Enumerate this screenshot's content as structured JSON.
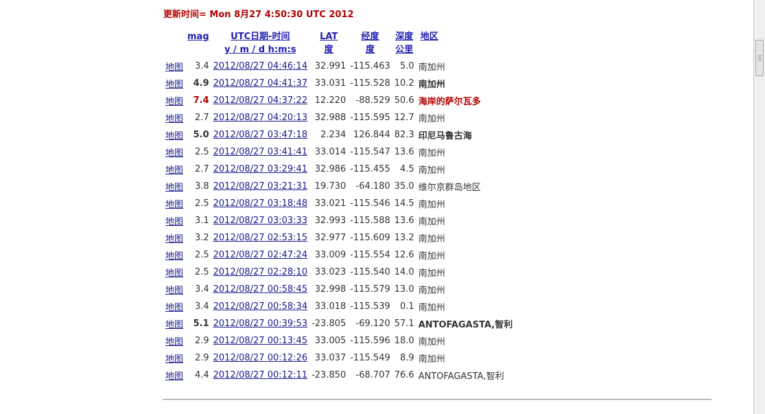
{
  "update": "更新时间= Mon 8月27 4:50:30 UTC 2012",
  "headers": {
    "mag": "mag",
    "date_line1": "UTC日期-时间",
    "date_line2": "y / m / d h:m:s",
    "lat_line1": "LAT",
    "lat_line2": "度",
    "lon_line1": "经度",
    "lon_line2": "度",
    "depth_line1": "深度",
    "depth_line2": "公里",
    "region": "地区"
  },
  "rows": [
    {
      "map": "地图",
      "mag": "3.4",
      "date": "2012/08/27 04:46:14",
      "lat": "32.991",
      "lon": "-115.463",
      "depth": "5.0",
      "region": "南加州",
      "style": "normal"
    },
    {
      "map": "地图",
      "mag": "4.9",
      "date": "2012/08/27 04:41:37",
      "lat": "33.031",
      "lon": "-115.528",
      "depth": "10.2",
      "region": "南加州",
      "style": "bold"
    },
    {
      "map": "地图",
      "mag": "7.4",
      "date": "2012/08/27 04:37:22",
      "lat": "12.220",
      "lon": "-88.529",
      "depth": "50.6",
      "region": "海岸的萨尔瓦多",
      "style": "red"
    },
    {
      "map": "地图",
      "mag": "2.7",
      "date": "2012/08/27 04:20:13",
      "lat": "32.988",
      "lon": "-115.595",
      "depth": "12.7",
      "region": "南加州",
      "style": "normal"
    },
    {
      "map": "地图",
      "mag": "5.0",
      "date": "2012/08/27 03:47:18",
      "lat": "2.234",
      "lon": "126.844",
      "depth": "82.3",
      "region": "印尼马鲁古海",
      "style": "bold"
    },
    {
      "map": "地图",
      "mag": "2.5",
      "date": "2012/08/27 03:41:41",
      "lat": "33.014",
      "lon": "-115.547",
      "depth": "13.6",
      "region": "南加州",
      "style": "normal"
    },
    {
      "map": "地图",
      "mag": "2.7",
      "date": "2012/08/27 03:29:41",
      "lat": "32.986",
      "lon": "-115.455",
      "depth": "4.5",
      "region": "南加州",
      "style": "normal"
    },
    {
      "map": "地图",
      "mag": "3.8",
      "date": "2012/08/27 03:21:31",
      "lat": "19.730",
      "lon": "-64.180",
      "depth": "35.0",
      "region": "维尔京群岛地区",
      "style": "normal"
    },
    {
      "map": "地图",
      "mag": "2.5",
      "date": "2012/08/27 03:18:48",
      "lat": "33.021",
      "lon": "-115.546",
      "depth": "14.5",
      "region": "南加州",
      "style": "normal"
    },
    {
      "map": "地图",
      "mag": "3.1",
      "date": "2012/08/27 03:03:33",
      "lat": "32.993",
      "lon": "-115.588",
      "depth": "13.6",
      "region": "南加州",
      "style": "normal"
    },
    {
      "map": "地图",
      "mag": "3.2",
      "date": "2012/08/27 02:53:15",
      "lat": "32.977",
      "lon": "-115.609",
      "depth": "13.2",
      "region": "南加州",
      "style": "normal"
    },
    {
      "map": "地图",
      "mag": "2.5",
      "date": "2012/08/27 02:47:24",
      "lat": "33.009",
      "lon": "-115.554",
      "depth": "12.6",
      "region": "南加州",
      "style": "normal"
    },
    {
      "map": "地图",
      "mag": "2.5",
      "date": "2012/08/27 02:28:10",
      "lat": "33.023",
      "lon": "-115.540",
      "depth": "14.0",
      "region": "南加州",
      "style": "normal"
    },
    {
      "map": "地图",
      "mag": "3.4",
      "date": "2012/08/27 00:58:45",
      "lat": "32.998",
      "lon": "-115.579",
      "depth": "13.0",
      "region": "南加州",
      "style": "normal"
    },
    {
      "map": "地图",
      "mag": "3.4",
      "date": "2012/08/27 00:58:34",
      "lat": "33.018",
      "lon": "-115.539",
      "depth": "0.1",
      "region": "南加州",
      "style": "normal"
    },
    {
      "map": "地图",
      "mag": "5.1",
      "date": "2012/08/27 00:39:53",
      "lat": "-23.805",
      "lon": "-69.120",
      "depth": "57.1",
      "region": "ANTOFAGASTA,智利",
      "style": "bold"
    },
    {
      "map": "地图",
      "mag": "2.9",
      "date": "2012/08/27 00:13:45",
      "lat": "33.005",
      "lon": "-115.596",
      "depth": "18.0",
      "region": "南加州",
      "style": "normal"
    },
    {
      "map": "地图",
      "mag": "2.9",
      "date": "2012/08/27 00:12:26",
      "lat": "33.037",
      "lon": "-115.549",
      "depth": "8.9",
      "region": "南加州",
      "style": "normal"
    },
    {
      "map": "地图",
      "mag": "4.4",
      "date": "2012/08/27 00:12:11",
      "lat": "-23.850",
      "lon": "-68.707",
      "depth": "76.6",
      "region": "ANTOFAGASTA,智利",
      "style": "normal"
    }
  ],
  "colors": {
    "red": "#b30000",
    "link": "#1a1a8a"
  }
}
